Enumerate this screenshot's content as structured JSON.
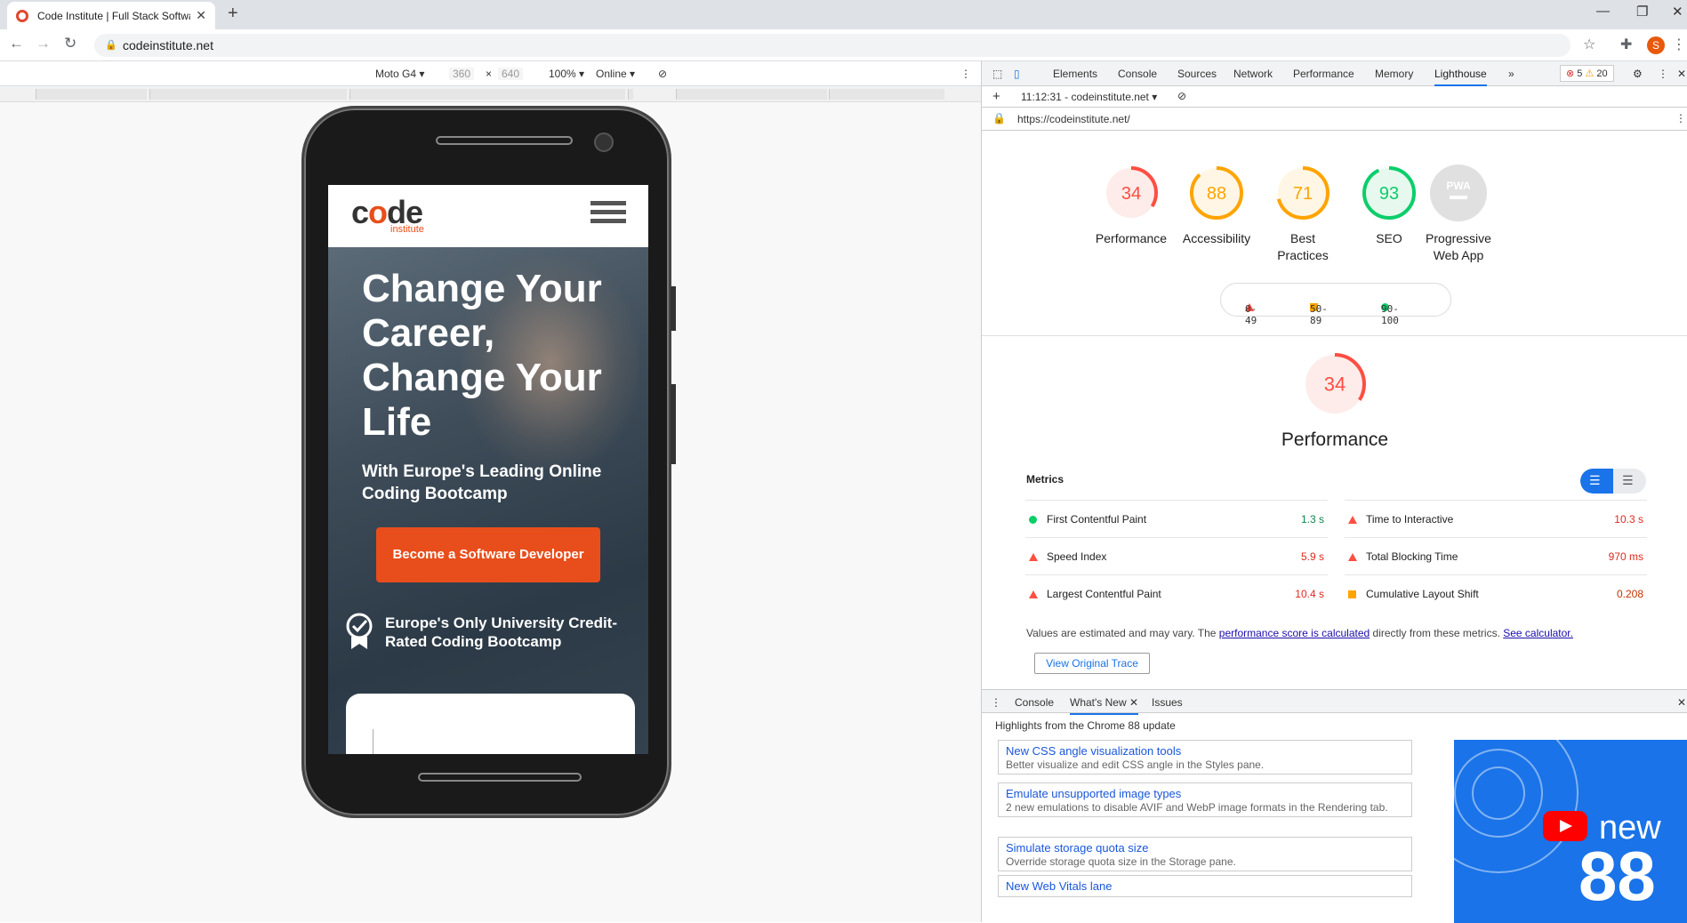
{
  "browser": {
    "tab_title": "Code Institute | Full Stack Softwa",
    "url": "codeinstitute.net",
    "avatar_letter": "S"
  },
  "device_toolbar": {
    "device": "Moto G4",
    "width": "360",
    "height": "640",
    "zoom": "100%",
    "network": "Online"
  },
  "site": {
    "logo_word_a": "c",
    "logo_word_o": "o",
    "logo_word_b": "de",
    "logo_sub": "institute",
    "hero_title": "Change Your Career, Change Your Life",
    "hero_sub": "With Europe's Leading Online Coding Bootcamp",
    "cta": "Become a Software Developer",
    "badge": "Europe's Only University Credit-Rated Coding Bootcamp"
  },
  "devtools": {
    "tabs": [
      "Elements",
      "Console",
      "Sources",
      "Network",
      "Performance",
      "Memory",
      "Lighthouse"
    ],
    "errors": "5",
    "warnings": "20",
    "report_time": "11:12:31 - codeinstitute.net",
    "report_url": "https://codeinstitute.net/",
    "scores": [
      {
        "value": 34,
        "label": "Performance",
        "color": "#ff4e42",
        "bg": "#fdecea"
      },
      {
        "value": 88,
        "label": "Accessibility",
        "color": "#ffa400",
        "bg": "#fff6e5"
      },
      {
        "value": 71,
        "label": "Best Practices",
        "color": "#ffa400",
        "bg": "#fff6e5"
      },
      {
        "value": 93,
        "label": "SEO",
        "color": "#0cce6b",
        "bg": "#e7f9ee"
      }
    ],
    "pwa_label": "Progressive Web App",
    "pwa_badge": "PWA",
    "legend": {
      "red": "0-49",
      "orange": "50-89",
      "green": "90-100"
    },
    "perf_score": 34,
    "perf_title": "Performance",
    "metrics_heading": "Metrics",
    "metrics": [
      {
        "name": "First Contentful Paint",
        "value": "1.3 s",
        "status": "pass"
      },
      {
        "name": "Time to Interactive",
        "value": "10.3 s",
        "status": "fail"
      },
      {
        "name": "Speed Index",
        "value": "5.9 s",
        "status": "fail"
      },
      {
        "name": "Total Blocking Time",
        "value": "970 ms",
        "status": "fail"
      },
      {
        "name": "Largest Contentful Paint",
        "value": "10.4 s",
        "status": "fail"
      },
      {
        "name": "Cumulative Layout Shift",
        "value": "0.208",
        "status": "average"
      }
    ],
    "note_pre": "Values are estimated and may vary. The ",
    "note_link1": "performance score is calculated",
    "note_mid": " directly from these metrics. ",
    "note_link2": "See calculator.",
    "trace_button": "View Original Trace"
  },
  "drawer": {
    "tabs": [
      "Console",
      "What's New",
      "Issues"
    ],
    "highlights": "Highlights from the Chrome 88 update",
    "items": [
      {
        "title": "New CSS angle visualization tools",
        "desc": "Better visualize and edit CSS angle in the Styles pane."
      },
      {
        "title": "Emulate unsupported image types",
        "desc": "2 new emulations to disable AVIF and WebP image formats in the Rendering tab."
      },
      {
        "title": "Simulate storage quota size",
        "desc": "Override storage quota size in the Storage pane."
      },
      {
        "title": "New Web Vitals lane",
        "desc": ""
      }
    ],
    "promo_new": "new",
    "promo_num": "88"
  }
}
